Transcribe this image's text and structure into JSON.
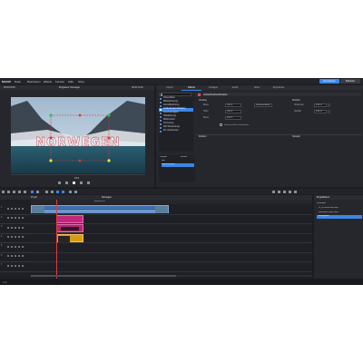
{
  "app": {
    "logo": "MAGIX",
    "menu": [
      "Datei",
      "Bearbeiten",
      "Effekte",
      "Fenster",
      "Hilfe",
      "Shop"
    ],
    "top_buttons": [
      "Exportieren",
      "Brennen"
    ],
    "colors": {
      "accent": "#3b86e8",
      "bg": "#1c1d21",
      "panel": "#26272c"
    }
  },
  "preview": {
    "tab_label": "Programm: Norwegen",
    "left_timecode": "00:00:00:00",
    "right_timecode": "00:00:13:19",
    "title_text": "NORWEGEN",
    "position": "0:13"
  },
  "inspector": {
    "tabs": [
      "Import",
      "Effekte",
      "Vorlagen",
      "Audio",
      "Store",
      "Keyframes"
    ],
    "active_tab": 1,
    "panel_title": "Größe/Position/Rotation",
    "categories": [
      "Videoeffekte",
      "Bildoptimierung",
      "Farbe/Belichtung",
      "Größe/Position/Rotation",
      "Geschwindigkeit",
      "Stabilisierung",
      "Bildkorrektur",
      "Verzerrung",
      "360°-Bearbeitung",
      "Ein-/Ausblenden"
    ],
    "selected_category": 3,
    "section_left": "Umfang",
    "section_right": "Position",
    "rows_left": [
      {
        "label": "Breite",
        "value": "100 %",
        "value2": "Seitenverhältnis"
      },
      {
        "label": "Höhe",
        "value": "100 %"
      },
      {
        "label": "Breite",
        "value": "100 %"
      }
    ],
    "checkbox_label": "Seitenverhältnis beibehalten",
    "rows_right": [
      {
        "label": "Horizontal",
        "value": "0.00 %"
      },
      {
        "label": "Vertikal",
        "value": "0.00 %"
      }
    ],
    "sub_left": "Rotation",
    "sub_right": "Spiegeln",
    "lower_head": "Objekte",
    "lower_col": "Effekte",
    "lower_items": [
      "Bild",
      "Größe/Position"
    ]
  },
  "timeline": {
    "project_label": "Norwegen",
    "left_label": "Projekt",
    "time_marker": "00:00:13:19",
    "track_numbers": [
      "1",
      "2",
      "3",
      "4",
      "5",
      "6",
      "7"
    ]
  },
  "right_panel": {
    "header": "Projektbaum",
    "items": [
      "Norwegen",
      "01_NORWEGEN.mp4",
      "Musikdatei (Sep.) Aust",
      "Hintergrund"
    ],
    "selected_item": 3
  },
  "status": {
    "left": "1.0x",
    "right": ""
  }
}
